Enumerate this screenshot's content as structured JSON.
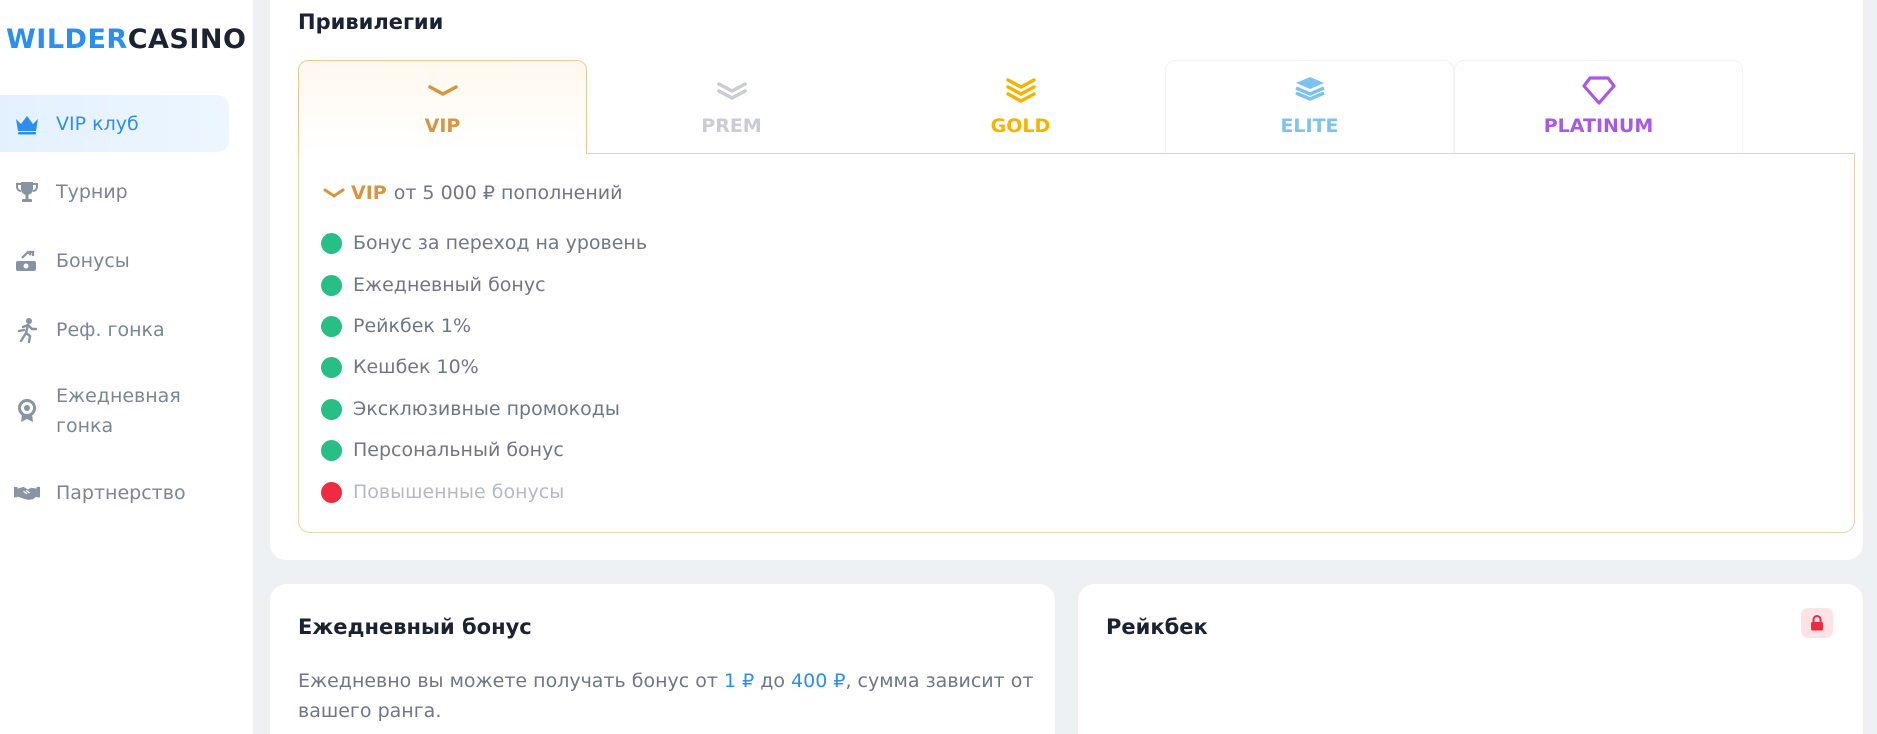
{
  "logo": {
    "part1": "WILDER",
    "part2": "CASINO"
  },
  "sidebar": {
    "items": [
      {
        "label": "VIP клуб",
        "icon": "crown-icon",
        "active": true
      },
      {
        "label": "Турнир",
        "icon": "trophy-icon",
        "active": false
      },
      {
        "label": "Бонусы",
        "icon": "money-icon",
        "active": false
      },
      {
        "label": "Реф. гонка",
        "icon": "runner-icon",
        "active": false
      },
      {
        "label": "Ежедневная гонка",
        "line1": "Ежедневная",
        "line2": "гонка",
        "icon": "medal-icon",
        "active": false
      },
      {
        "label": "Партнерство",
        "icon": "handshake-icon",
        "active": false
      }
    ]
  },
  "privileges": {
    "title": "Привилегии",
    "tabs": [
      {
        "label": "VIP",
        "color": "#d8953f",
        "icon": "chevron-icon",
        "active": true
      },
      {
        "label": "PREM",
        "color": "#c8ccd3",
        "icon": "double-chevron-icon",
        "active": false
      },
      {
        "label": "GOLD",
        "color": "#f5b400",
        "icon": "triple-chevron-icon",
        "active": false
      },
      {
        "label": "ELITE",
        "color": "#7cc3ee",
        "icon": "layers-icon",
        "active": false
      },
      {
        "label": "PLATINUM",
        "color": "#a65ae6",
        "icon": "diamond-icon",
        "active": false
      }
    ],
    "requirement": {
      "tier": "VIP",
      "text": "от 5 000 ₽ пополнений"
    },
    "perks": [
      {
        "text": "Бонус за переход на уровень",
        "enabled": true
      },
      {
        "text": "Ежедневный бонус",
        "enabled": true
      },
      {
        "text": "Рейкбек 1%",
        "enabled": true
      },
      {
        "text": "Кешбек 10%",
        "enabled": true
      },
      {
        "text": "Эксклюзивные промокоды",
        "enabled": true
      },
      {
        "text": "Персональный бонус",
        "enabled": true
      },
      {
        "text": "Повышенные бонусы",
        "enabled": false
      }
    ]
  },
  "daily_bonus": {
    "title": "Ежедневный бонус",
    "desc_prefix": "Ежедневно вы можете получать бонус от ",
    "min": "1 ₽",
    "desc_mid": " до ",
    "max": "400 ₽",
    "desc_suffix": ", сумма зависит от вашего ранга."
  },
  "rakeback": {
    "title": "Рейкбек",
    "status_icon": "lock-icon"
  }
}
